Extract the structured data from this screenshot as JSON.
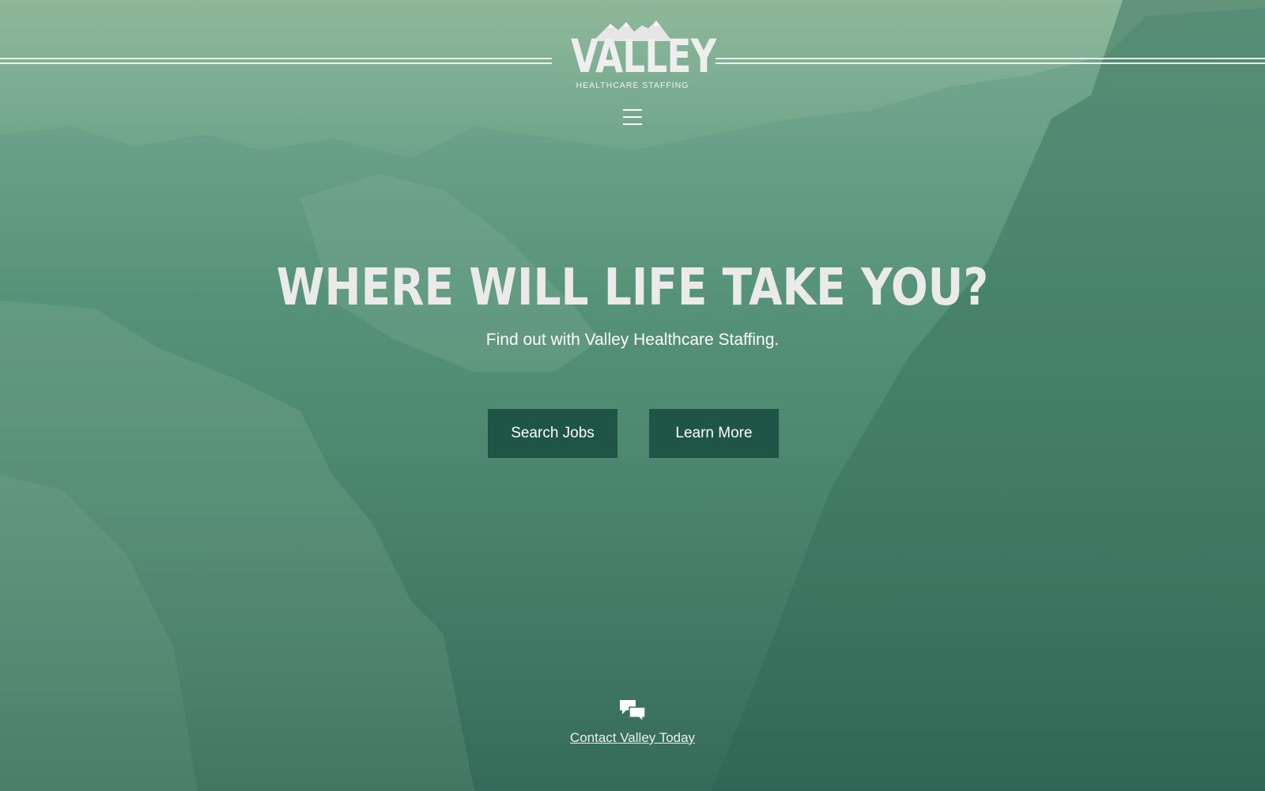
{
  "brand": {
    "name": "VALLEY",
    "tagline": "HEALTHCARE STAFFING"
  },
  "nav": {
    "menu_icon": "hamburger-icon"
  },
  "hero": {
    "headline": "WHERE WILL LIFE TAKE YOU?",
    "subheadline": "Find out with Valley Healthcare Staffing.",
    "buttons": {
      "search_jobs": "Search Jobs",
      "learn_more": "Learn More"
    }
  },
  "contact": {
    "icon": "chat-bubbles-icon",
    "label": "Contact Valley Today"
  },
  "colors": {
    "overlay_green": "#3a7a64",
    "button_bg": "#1f5546",
    "text": "#ffffff"
  }
}
